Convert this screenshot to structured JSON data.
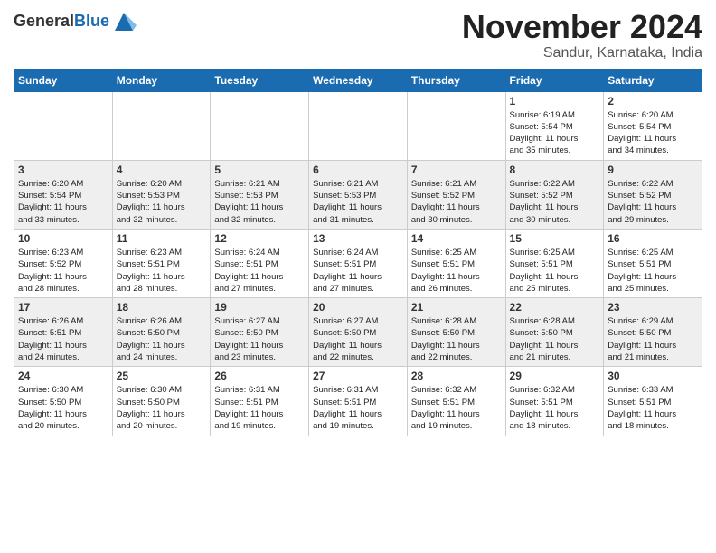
{
  "header": {
    "logo_general": "General",
    "logo_blue": "Blue",
    "month_title": "November 2024",
    "location": "Sandur, Karnataka, India"
  },
  "weekdays": [
    "Sunday",
    "Monday",
    "Tuesday",
    "Wednesday",
    "Thursday",
    "Friday",
    "Saturday"
  ],
  "weeks": [
    [
      {
        "day": "",
        "info": ""
      },
      {
        "day": "",
        "info": ""
      },
      {
        "day": "",
        "info": ""
      },
      {
        "day": "",
        "info": ""
      },
      {
        "day": "",
        "info": ""
      },
      {
        "day": "1",
        "info": "Sunrise: 6:19 AM\nSunset: 5:54 PM\nDaylight: 11 hours\nand 35 minutes."
      },
      {
        "day": "2",
        "info": "Sunrise: 6:20 AM\nSunset: 5:54 PM\nDaylight: 11 hours\nand 34 minutes."
      }
    ],
    [
      {
        "day": "3",
        "info": "Sunrise: 6:20 AM\nSunset: 5:54 PM\nDaylight: 11 hours\nand 33 minutes."
      },
      {
        "day": "4",
        "info": "Sunrise: 6:20 AM\nSunset: 5:53 PM\nDaylight: 11 hours\nand 32 minutes."
      },
      {
        "day": "5",
        "info": "Sunrise: 6:21 AM\nSunset: 5:53 PM\nDaylight: 11 hours\nand 32 minutes."
      },
      {
        "day": "6",
        "info": "Sunrise: 6:21 AM\nSunset: 5:53 PM\nDaylight: 11 hours\nand 31 minutes."
      },
      {
        "day": "7",
        "info": "Sunrise: 6:21 AM\nSunset: 5:52 PM\nDaylight: 11 hours\nand 30 minutes."
      },
      {
        "day": "8",
        "info": "Sunrise: 6:22 AM\nSunset: 5:52 PM\nDaylight: 11 hours\nand 30 minutes."
      },
      {
        "day": "9",
        "info": "Sunrise: 6:22 AM\nSunset: 5:52 PM\nDaylight: 11 hours\nand 29 minutes."
      }
    ],
    [
      {
        "day": "10",
        "info": "Sunrise: 6:23 AM\nSunset: 5:52 PM\nDaylight: 11 hours\nand 28 minutes."
      },
      {
        "day": "11",
        "info": "Sunrise: 6:23 AM\nSunset: 5:51 PM\nDaylight: 11 hours\nand 28 minutes."
      },
      {
        "day": "12",
        "info": "Sunrise: 6:24 AM\nSunset: 5:51 PM\nDaylight: 11 hours\nand 27 minutes."
      },
      {
        "day": "13",
        "info": "Sunrise: 6:24 AM\nSunset: 5:51 PM\nDaylight: 11 hours\nand 27 minutes."
      },
      {
        "day": "14",
        "info": "Sunrise: 6:25 AM\nSunset: 5:51 PM\nDaylight: 11 hours\nand 26 minutes."
      },
      {
        "day": "15",
        "info": "Sunrise: 6:25 AM\nSunset: 5:51 PM\nDaylight: 11 hours\nand 25 minutes."
      },
      {
        "day": "16",
        "info": "Sunrise: 6:25 AM\nSunset: 5:51 PM\nDaylight: 11 hours\nand 25 minutes."
      }
    ],
    [
      {
        "day": "17",
        "info": "Sunrise: 6:26 AM\nSunset: 5:51 PM\nDaylight: 11 hours\nand 24 minutes."
      },
      {
        "day": "18",
        "info": "Sunrise: 6:26 AM\nSunset: 5:50 PM\nDaylight: 11 hours\nand 24 minutes."
      },
      {
        "day": "19",
        "info": "Sunrise: 6:27 AM\nSunset: 5:50 PM\nDaylight: 11 hours\nand 23 minutes."
      },
      {
        "day": "20",
        "info": "Sunrise: 6:27 AM\nSunset: 5:50 PM\nDaylight: 11 hours\nand 22 minutes."
      },
      {
        "day": "21",
        "info": "Sunrise: 6:28 AM\nSunset: 5:50 PM\nDaylight: 11 hours\nand 22 minutes."
      },
      {
        "day": "22",
        "info": "Sunrise: 6:28 AM\nSunset: 5:50 PM\nDaylight: 11 hours\nand 21 minutes."
      },
      {
        "day": "23",
        "info": "Sunrise: 6:29 AM\nSunset: 5:50 PM\nDaylight: 11 hours\nand 21 minutes."
      }
    ],
    [
      {
        "day": "24",
        "info": "Sunrise: 6:30 AM\nSunset: 5:50 PM\nDaylight: 11 hours\nand 20 minutes."
      },
      {
        "day": "25",
        "info": "Sunrise: 6:30 AM\nSunset: 5:50 PM\nDaylight: 11 hours\nand 20 minutes."
      },
      {
        "day": "26",
        "info": "Sunrise: 6:31 AM\nSunset: 5:51 PM\nDaylight: 11 hours\nand 19 minutes."
      },
      {
        "day": "27",
        "info": "Sunrise: 6:31 AM\nSunset: 5:51 PM\nDaylight: 11 hours\nand 19 minutes."
      },
      {
        "day": "28",
        "info": "Sunrise: 6:32 AM\nSunset: 5:51 PM\nDaylight: 11 hours\nand 19 minutes."
      },
      {
        "day": "29",
        "info": "Sunrise: 6:32 AM\nSunset: 5:51 PM\nDaylight: 11 hours\nand 18 minutes."
      },
      {
        "day": "30",
        "info": "Sunrise: 6:33 AM\nSunset: 5:51 PM\nDaylight: 11 hours\nand 18 minutes."
      }
    ]
  ]
}
